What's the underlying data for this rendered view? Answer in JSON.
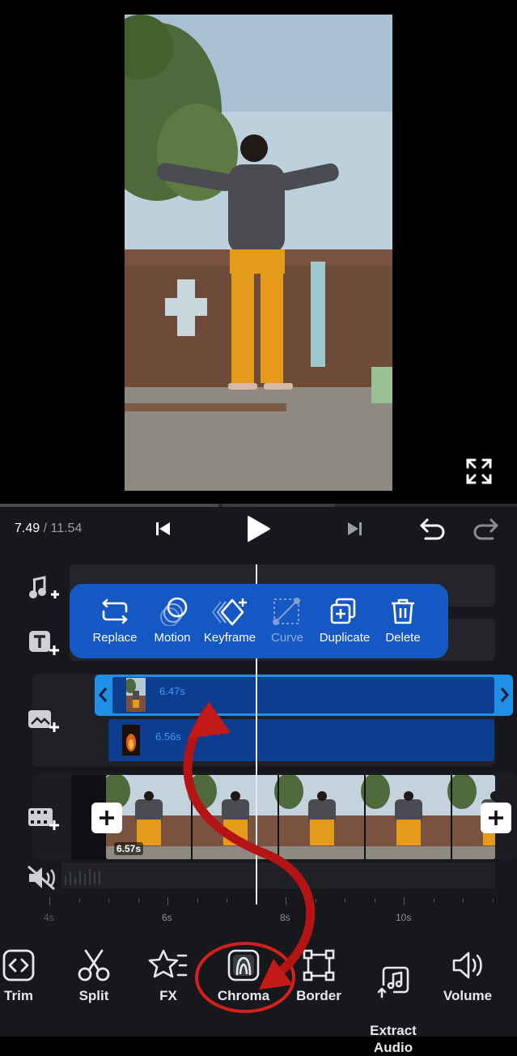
{
  "player": {
    "current_time": "7.49",
    "separator": " / ",
    "total_time": "11.54"
  },
  "context_menu": {
    "items": [
      {
        "label": "Replace",
        "icon": "replace-icon",
        "enabled": true
      },
      {
        "label": "Motion",
        "icon": "motion-icon",
        "enabled": true
      },
      {
        "label": "Keyframe",
        "icon": "keyframe-icon",
        "enabled": true
      },
      {
        "label": "Curve",
        "icon": "curve-icon",
        "enabled": false
      },
      {
        "label": "Duplicate",
        "icon": "duplicate-icon",
        "enabled": true
      },
      {
        "label": "Delete",
        "icon": "delete-icon",
        "enabled": true
      }
    ]
  },
  "tracks": {
    "overlay_clip_1_duration": "6.47s",
    "overlay_clip_2_duration": "6.56s",
    "main_clip_duration": "6.57s"
  },
  "ruler": {
    "labels": [
      "4s",
      "6s",
      "8s",
      "10s"
    ]
  },
  "toolbar": {
    "items": [
      {
        "label": "Trim",
        "icon": "trim-icon"
      },
      {
        "label": "Split",
        "icon": "scissors-icon"
      },
      {
        "label": "FX",
        "icon": "fx-star-icon"
      },
      {
        "label": "Chroma",
        "icon": "chroma-icon"
      },
      {
        "label": "Border",
        "icon": "border-icon"
      },
      {
        "label": "Extract\nAudio",
        "icon": "extract-audio-icon"
      },
      {
        "label": "Volume",
        "icon": "volume-icon"
      }
    ]
  },
  "colors": {
    "accent_blue": "#1f6fe0",
    "menu_blue": "#1558c4",
    "clip_blue": "#0c3d8f",
    "annotation_red": "#d41f1f"
  }
}
